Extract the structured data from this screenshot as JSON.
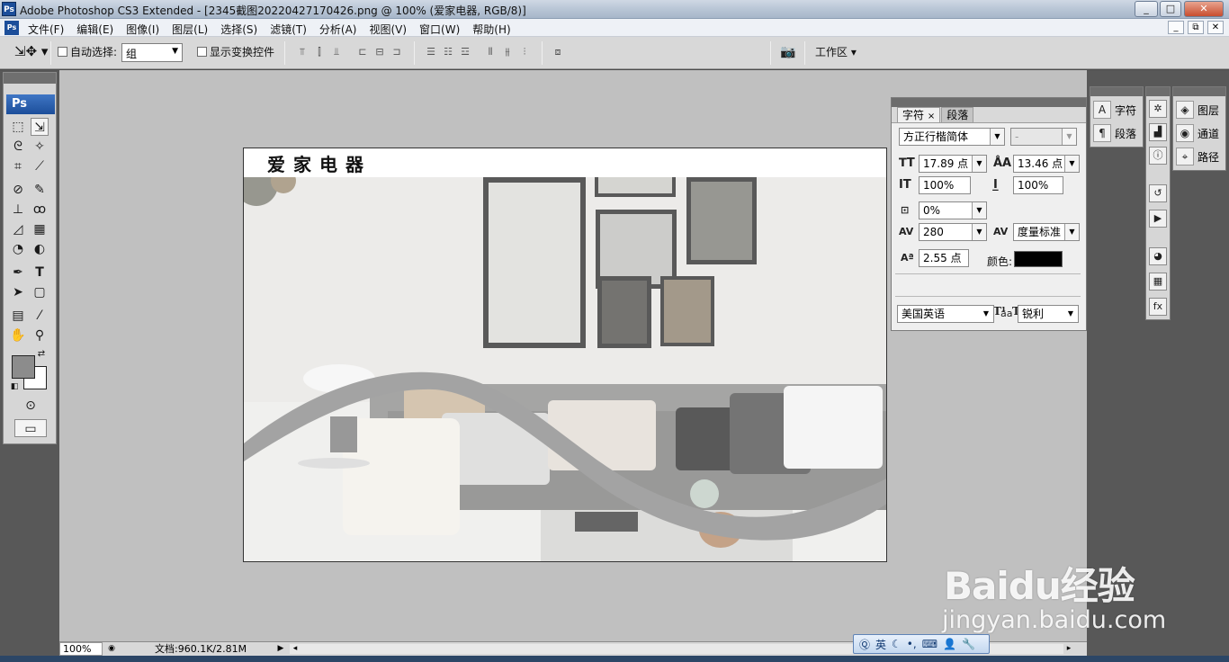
{
  "window": {
    "title": "Adobe Photoshop CS3 Extended - [2345截图20220427170426.png @ 100% (爱家电器, RGB/8)]",
    "controls": [
      "_",
      "□",
      "✕"
    ]
  },
  "menu": {
    "items": [
      "文件(F)",
      "编辑(E)",
      "图像(I)",
      "图层(L)",
      "选择(S)",
      "滤镜(T)",
      "分析(A)",
      "视图(V)",
      "窗口(W)",
      "帮助(H)"
    ],
    "doc_controls": [
      "_",
      "⧉",
      "✕"
    ]
  },
  "options_bar": {
    "auto_select_label": "自动选择:",
    "auto_select_value": "组",
    "show_transform_label": "显示变换控件",
    "workspace_label": "工作区"
  },
  "document": {
    "heading": "爱家电器",
    "accent_color": "#8a8a8a"
  },
  "status_bar": {
    "zoom": "100%",
    "doc_info": "文档:960.1K/2.81M"
  },
  "character_panel": {
    "tabs": [
      "字符",
      "段落"
    ],
    "font_family": "方正行楷简体",
    "font_style": "-",
    "font_size": "17.89 点",
    "leading": "13.46 点",
    "vertical_scale": "100%",
    "horizontal_scale": "100%",
    "tsume": "0%",
    "tracking": "280",
    "kerning": "度量标准",
    "baseline_shift": "2.55 点",
    "color_label": "颜色:",
    "text_color": "#000000",
    "style_buttons": [
      "T",
      "T",
      "TT",
      "Tт",
      "T¹",
      "T,",
      "T",
      "Ŧ"
    ],
    "language": "美国英语",
    "antialias_icon_label": "aa",
    "antialias": "锐利"
  },
  "dock_panels": {
    "group1": [
      "字符",
      "段落"
    ],
    "group3": [
      "图层",
      "通道",
      "路径"
    ]
  },
  "ime_bar": {
    "mode": "英"
  },
  "watermark": {
    "brand": "Baidu经验",
    "url": "jingyan.baidu.com"
  }
}
